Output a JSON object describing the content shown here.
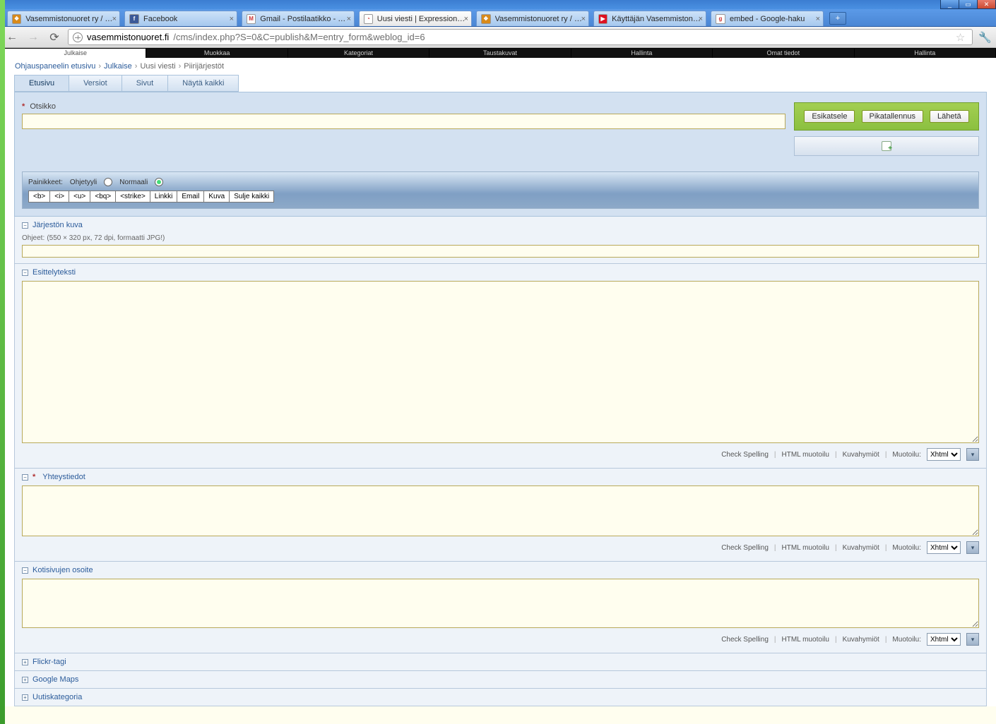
{
  "window_controls": {
    "min": "_",
    "max": "▭",
    "close": "✕"
  },
  "tabs": [
    {
      "label": "Vasemmistonuoret ry / Toim",
      "fav": "❖",
      "favbg": "#d88a1a"
    },
    {
      "label": "Facebook",
      "fav": "f",
      "favbg": "#3b5998"
    },
    {
      "label": "Gmail - Postilaatikko - eliisa",
      "fav": "M",
      "favbg": "#fff"
    },
    {
      "label": "Uusi viesti | ExpressionEngin",
      "fav": "◔",
      "favbg": "#fff",
      "active": true
    },
    {
      "label": "Vasemmistonuoret ry / Etel",
      "fav": "❖",
      "favbg": "#d88a1a"
    },
    {
      "label": "Käyttäjän Vasemmistonuore",
      "fav": "▶",
      "favbg": "#d12"
    },
    {
      "label": "embed - Google-haku",
      "fav": "g",
      "favbg": "#fff"
    }
  ],
  "newtab": "+",
  "nav": {
    "back": "←",
    "fwd": "→",
    "reload": "⟳"
  },
  "url": {
    "host": "vasemmistonuoret.fi",
    "path": "/cms/index.php?S=0&C=publish&M=entry_form&weblog_id=6"
  },
  "star": "☆",
  "wrench": "🔧",
  "topnav": [
    "Julkaise",
    "Muokkaa",
    "Kategoriat",
    "Taustakuvat",
    "Hallinta",
    "Omat tiedot",
    "Hallinta"
  ],
  "crumbs": {
    "items": [
      "Ohjauspaneelin etusivu",
      "Julkaise",
      "Uusi viesti",
      "Piirijärjestöt"
    ],
    "sep": "›"
  },
  "inner_tabs": [
    "Etusivu",
    "Versiot",
    "Sivut",
    "Näytä kaikki"
  ],
  "otsikko_label": "Otsikko",
  "buttons": {
    "preview": "Esikatsele",
    "quicksave": "Pikatallennus",
    "submit": "Lähetä"
  },
  "fmt": {
    "label": "Painikkeet:",
    "r1": "Ohjetyyli",
    "r2": "Normaali",
    "btns": [
      "<b>",
      "<i>",
      "<u>",
      "<bq>",
      "<strike>",
      "Linkki",
      "Email",
      "Kuva",
      "Sulje kaikki"
    ]
  },
  "sections": {
    "kuva": {
      "title": "Järjestön kuva",
      "note_label": "Ohjeet:",
      "note": "(550 × 320 px, 72 dpi, formaatti JPG!)"
    },
    "esittely": {
      "title": "Esittelyteksti"
    },
    "yhteys": {
      "title": "Yhteystiedot",
      "required": true
    },
    "koti": {
      "title": "Kotisivujen osoite"
    },
    "flickr": {
      "title": "Flickr-tagi"
    },
    "gmaps": {
      "title": "Google Maps"
    },
    "kategoria": {
      "title": "Uutiskategoria"
    }
  },
  "tools": {
    "spell": "Check Spelling",
    "html": "HTML muotoilu",
    "glossary": "Kuvahymiöt",
    "fmt_label": "Muotoilu:",
    "fmt_value": "Xhtml"
  },
  "tw_open": "−",
  "tw_closed": "+"
}
